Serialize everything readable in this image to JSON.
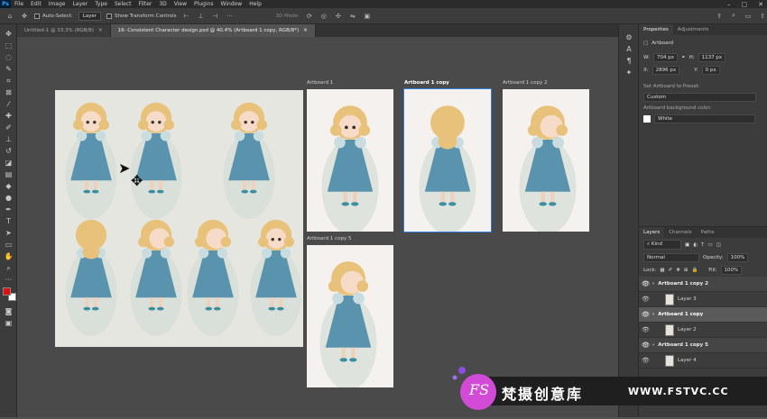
{
  "menu": [
    "File",
    "Edit",
    "Image",
    "Layer",
    "Type",
    "Select",
    "Filter",
    "3D",
    "View",
    "Plugins",
    "Window",
    "Help"
  ],
  "options": {
    "auto_select_label": "Auto-Select:",
    "auto_select_value": "Layer",
    "show_transform_label": "Show Transform Controls",
    "mode_label": "3D Mode:"
  },
  "tabs": [
    {
      "label": "Untitled-1 @ 33.3% (RGB/8)"
    },
    {
      "label": "16- Consistent Character design.psd @ 40.4% (Artboard 1 copy, RGB/8*)"
    }
  ],
  "artboards": {
    "a1": "Artboard 1",
    "a1c": "Artboard 1 copy",
    "a1c2": "Artboard 1 copy 2",
    "a1c5": "Artboard 1 copy 5"
  },
  "properties": {
    "tab_properties": "Properties",
    "tab_adjustments": "Adjustments",
    "type_label": "Artboard",
    "w_label": "W:",
    "w": "704 px",
    "h_label": "H:",
    "h": "1137 px",
    "x_label": "X:",
    "x": "2896 px",
    "y_label": "Y:",
    "y": "0 px",
    "preset_label": "Set Artboard to Preset:",
    "preset_value": "Custom",
    "bg_label": "Artboard background color:",
    "bg_value": "White"
  },
  "layers": {
    "tab_layers": "Layers",
    "tab_channels": "Channels",
    "tab_paths": "Paths",
    "kind": "Kind",
    "blend": "Normal",
    "opacity_label": "Opacity:",
    "opacity": "100%",
    "lock_label": "Lock:",
    "fill_label": "Fill:",
    "fill": "100%",
    "rows": [
      {
        "name": "Artboard 1 copy 2",
        "type": "group"
      },
      {
        "name": "Layer 3",
        "type": "layer"
      },
      {
        "name": "Artboard 1 copy",
        "type": "group-sel"
      },
      {
        "name": "Layer 2",
        "type": "layer"
      },
      {
        "name": "Artboard 1 copy 5",
        "type": "group"
      },
      {
        "name": "Layer 4",
        "type": "layer"
      }
    ]
  },
  "watermark": {
    "logo": "FS",
    "cn": "梵摄创意库",
    "url": "WWW.FSTVC.CC"
  },
  "colors": {
    "fg": "#e01010",
    "bg": "#ffffff",
    "dress": "#5a93ad",
    "hair": "#e8c27a"
  }
}
